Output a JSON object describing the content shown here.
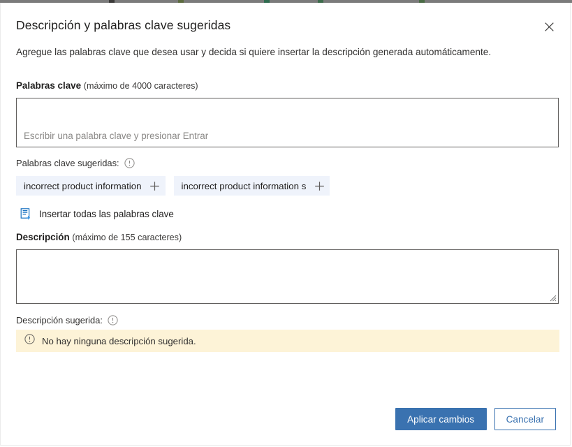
{
  "dialog": {
    "title": "Descripción y palabras clave sugeridas",
    "subtitle": "Agregue las palabras clave que desea usar y decida si quiere insertar la descripción generada automáticamente.",
    "close_icon": "close-icon"
  },
  "keywords": {
    "label_strong": "Palabras clave",
    "label_hint": "(máximo de 4000 caracteres)",
    "value": "",
    "placeholder": "Escribir una palabra clave y presionar Entrar",
    "suggested_label": "Palabras clave sugeridas:",
    "suggested_info_icon": "info-icon",
    "chips": [
      {
        "label": "incorrect product information",
        "add_icon": "plus-icon"
      },
      {
        "label": "incorrect product information s",
        "add_icon": "plus-icon"
      }
    ],
    "insert_all_label": "Insertar todas las palabras clave",
    "insert_all_icon": "insert-list-icon"
  },
  "description": {
    "label_strong": "Descripción",
    "label_hint": "(máximo de 155 caracteres)",
    "value": "",
    "placeholder": "",
    "suggested_label": "Descripción sugerida:",
    "suggested_info_icon": "info-icon",
    "banner_icon": "warning-icon",
    "banner_text": "No hay ninguna descripción sugerida."
  },
  "footer": {
    "apply_label": "Aplicar cambios",
    "cancel_label": "Cancelar"
  },
  "colors": {
    "accent": "#3a72b0",
    "chip_bg": "#eff3fb",
    "banner_bg": "#fdf3d7",
    "border": "#605e5c",
    "text": "#201f1e"
  }
}
